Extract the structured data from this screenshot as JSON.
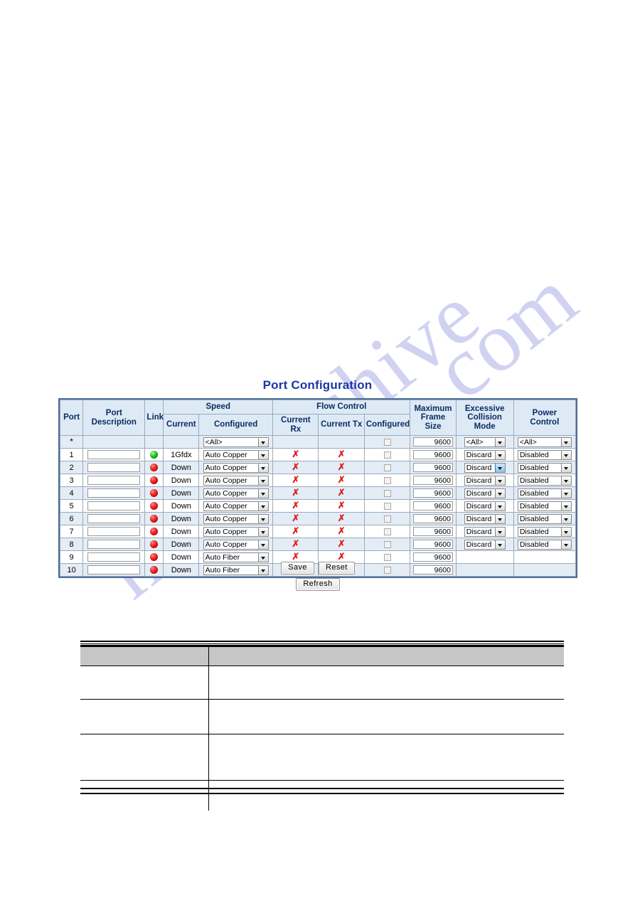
{
  "watermark": {
    "line1": "manualshive",
    "line2": ".com"
  },
  "page": {
    "title": "Port Configuration"
  },
  "table": {
    "headers": {
      "port": "Port",
      "port_description": "Port Description",
      "link": "Link",
      "speed": "Speed",
      "speed_current": "Current",
      "speed_configured": "Configured",
      "flow_control": "Flow Control",
      "fc_current_rx": "Current Rx",
      "fc_current_tx": "Current Tx",
      "fc_configured": "Configured",
      "maximum_frame_size": "Maximum\nFrame Size",
      "maximum_frame_size_l1": "Maximum",
      "maximum_frame_size_l2": "Frame Size",
      "excessive_collision_mode_l1": "Excessive",
      "excessive_collision_mode_l2": "Collision Mode",
      "power_control_l1": "Power",
      "power_control_l2": "Control"
    },
    "rows": [
      {
        "port": "*",
        "description": "",
        "has_description_input": false,
        "link": "",
        "has_led": false,
        "led_state": "",
        "speed_current": "",
        "speed_configured": "<All>",
        "current_rx": "",
        "current_tx": "",
        "fc_configured_checked": false,
        "max_frame_size": "9600",
        "excessive_collision_mode": "<All>",
        "power_control": "<All>",
        "ecm_focused": false
      },
      {
        "port": "1",
        "description": "",
        "has_description_input": true,
        "link": "up",
        "has_led": true,
        "led_state": "up",
        "speed_current": "1Gfdx",
        "speed_configured": "Auto Copper",
        "current_rx": "✗",
        "current_tx": "✗",
        "fc_configured_checked": false,
        "max_frame_size": "9600",
        "excessive_collision_mode": "Discard",
        "power_control": "Disabled",
        "ecm_focused": false
      },
      {
        "port": "2",
        "description": "",
        "has_description_input": true,
        "link": "down",
        "has_led": true,
        "led_state": "down",
        "speed_current": "Down",
        "speed_configured": "Auto Copper",
        "current_rx": "✗",
        "current_tx": "✗",
        "fc_configured_checked": false,
        "max_frame_size": "9600",
        "excessive_collision_mode": "Discard",
        "power_control": "Disabled",
        "ecm_focused": true
      },
      {
        "port": "3",
        "description": "",
        "has_description_input": true,
        "link": "down",
        "has_led": true,
        "led_state": "down",
        "speed_current": "Down",
        "speed_configured": "Auto Copper",
        "current_rx": "✗",
        "current_tx": "✗",
        "fc_configured_checked": false,
        "max_frame_size": "9600",
        "excessive_collision_mode": "Discard",
        "power_control": "Disabled",
        "ecm_focused": false
      },
      {
        "port": "4",
        "description": "",
        "has_description_input": true,
        "link": "down",
        "has_led": true,
        "led_state": "down",
        "speed_current": "Down",
        "speed_configured": "Auto Copper",
        "current_rx": "✗",
        "current_tx": "✗",
        "fc_configured_checked": false,
        "max_frame_size": "9600",
        "excessive_collision_mode": "Discard",
        "power_control": "Disabled",
        "ecm_focused": false
      },
      {
        "port": "5",
        "description": "",
        "has_description_input": true,
        "link": "down",
        "has_led": true,
        "led_state": "down",
        "speed_current": "Down",
        "speed_configured": "Auto Copper",
        "current_rx": "✗",
        "current_tx": "✗",
        "fc_configured_checked": false,
        "max_frame_size": "9600",
        "excessive_collision_mode": "Discard",
        "power_control": "Disabled",
        "ecm_focused": false
      },
      {
        "port": "6",
        "description": "",
        "has_description_input": true,
        "link": "down",
        "has_led": true,
        "led_state": "down",
        "speed_current": "Down",
        "speed_configured": "Auto Copper",
        "current_rx": "✗",
        "current_tx": "✗",
        "fc_configured_checked": false,
        "max_frame_size": "9600",
        "excessive_collision_mode": "Discard",
        "power_control": "Disabled",
        "ecm_focused": false
      },
      {
        "port": "7",
        "description": "",
        "has_description_input": true,
        "link": "down",
        "has_led": true,
        "led_state": "down",
        "speed_current": "Down",
        "speed_configured": "Auto Copper",
        "current_rx": "✗",
        "current_tx": "✗",
        "fc_configured_checked": false,
        "max_frame_size": "9600",
        "excessive_collision_mode": "Discard",
        "power_control": "Disabled",
        "ecm_focused": false
      },
      {
        "port": "8",
        "description": "",
        "has_description_input": true,
        "link": "down",
        "has_led": true,
        "led_state": "down",
        "speed_current": "Down",
        "speed_configured": "Auto Copper",
        "current_rx": "✗",
        "current_tx": "✗",
        "fc_configured_checked": false,
        "max_frame_size": "9600",
        "excessive_collision_mode": "Discard",
        "power_control": "Disabled",
        "ecm_focused": false
      },
      {
        "port": "9",
        "description": "",
        "has_description_input": true,
        "link": "down",
        "has_led": true,
        "led_state": "down",
        "speed_current": "Down",
        "speed_configured": "Auto Fiber",
        "current_rx": "✗",
        "current_tx": "✗",
        "fc_configured_checked": false,
        "max_frame_size": "9600",
        "excessive_collision_mode": "",
        "power_control": "",
        "ecm_focused": false
      },
      {
        "port": "10",
        "description": "",
        "has_description_input": true,
        "link": "down",
        "has_led": true,
        "led_state": "down",
        "speed_current": "Down",
        "speed_configured": "Auto Fiber",
        "current_rx": "✗",
        "current_tx": "✗",
        "fc_configured_checked": false,
        "max_frame_size": "9600",
        "excessive_collision_mode": "",
        "power_control": "",
        "ecm_focused": false
      }
    ]
  },
  "buttons": {
    "save": "Save",
    "reset": "Reset",
    "refresh": "Refresh"
  },
  "description_table": {
    "header": [
      "",
      ""
    ],
    "rows": [
      [
        "",
        ""
      ],
      [
        "",
        ""
      ],
      [
        "",
        ""
      ],
      [
        "",
        ""
      ]
    ]
  },
  "colors": {
    "title": "#1c36a8",
    "header_bg": "#ddeaf6",
    "row_alt_bg": "#e4ecf5",
    "table_border": "#4a6c96",
    "led_up": "#19c21a",
    "led_down": "#e81d1d",
    "x_mark": "#e01b1b",
    "watermark": "#c9cbf0",
    "desc_header_bg": "#c6c6c6"
  }
}
